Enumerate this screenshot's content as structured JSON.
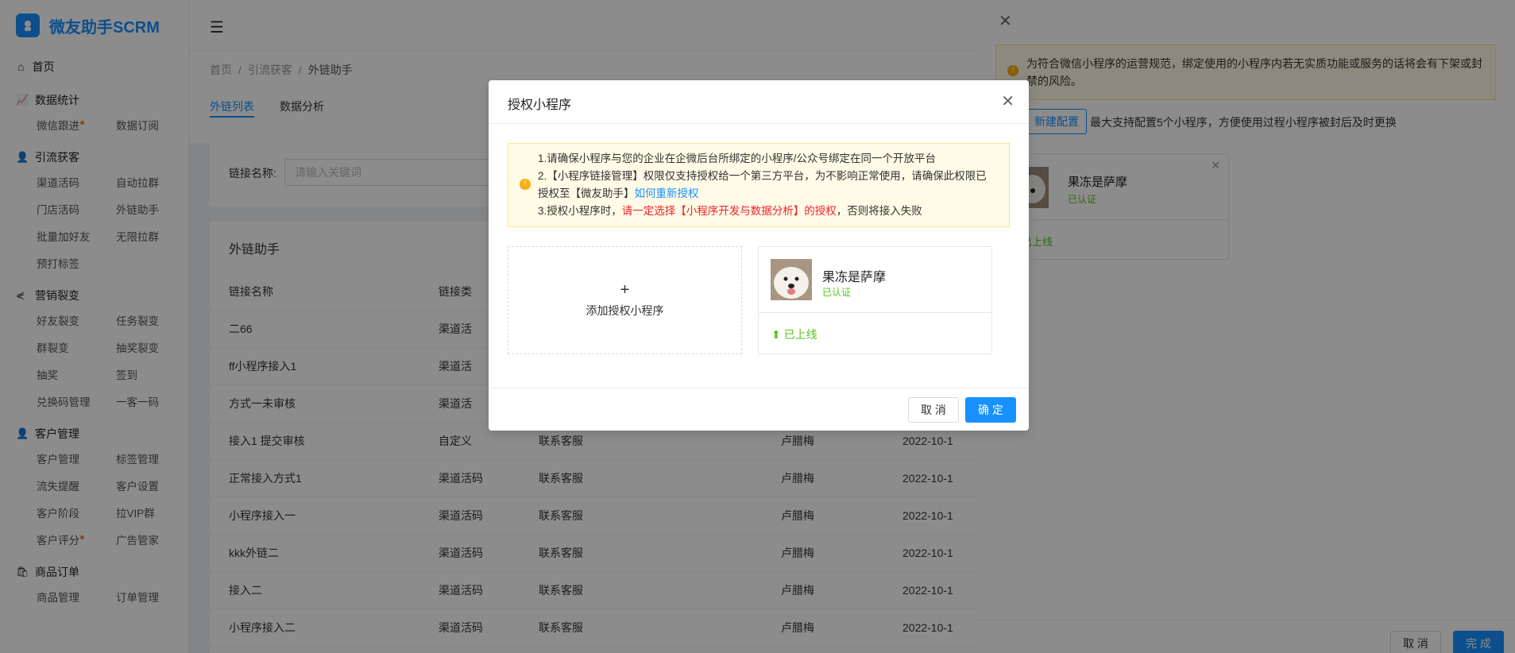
{
  "app": {
    "title": "微友助手SCRM"
  },
  "sidebar": {
    "home": "首页",
    "groups": [
      {
        "title": "数据统计",
        "items": [
          "微信跟进",
          "数据订阅"
        ]
      },
      {
        "title": "引流获客",
        "items": [
          "渠道活码",
          "自动拉群",
          "门店活码",
          "外链助手",
          "批量加好友",
          "无限拉群",
          "预打标签"
        ]
      },
      {
        "title": "营销裂变",
        "items": [
          "好友裂变",
          "任务裂变",
          "群裂变",
          "抽奖裂变",
          "抽奖",
          "签到",
          "兑换码管理",
          "一客一码"
        ]
      },
      {
        "title": "客户管理",
        "items": [
          "客户管理",
          "标签管理",
          "流失提醒",
          "客户设置",
          "客户阶段",
          "拉VIP群",
          "客户评分",
          "广告管家"
        ]
      },
      {
        "title": "商品订单",
        "items": [
          "商品管理",
          "订单管理"
        ]
      }
    ]
  },
  "breadcrumb": [
    "首页",
    "引流获客",
    "外链助手"
  ],
  "breadcrumb_sep": "/",
  "tabs": [
    "外链列表",
    "数据分析"
  ],
  "filter": {
    "label": "链接名称:",
    "placeholder": "请输入关键词"
  },
  "list": {
    "title": "外链助手",
    "headers": [
      "链接名称",
      "链接类"
    ],
    "rows": [
      [
        "二66",
        "渠道活",
        "",
        "",
        ""
      ],
      [
        "ff小程序接入1",
        "渠道活",
        "",
        "",
        ""
      ],
      [
        "方式一未审核",
        "渠道活",
        "",
        "",
        ""
      ],
      [
        "接入1 提交审核",
        "自定义",
        "联系客服",
        "卢腊梅",
        "2022-10-1"
      ],
      [
        "正常接入方式1",
        "渠道活码",
        "联系客服",
        "卢腊梅",
        "2022-10-1"
      ],
      [
        "小程序接入一",
        "渠道活码",
        "联系客服",
        "卢腊梅",
        "2022-10-1"
      ],
      [
        "kkk外链二",
        "渠道活码",
        "联系客服",
        "卢腊梅",
        "2022-10-1"
      ],
      [
        "接入二",
        "渠道活码",
        "联系客服",
        "卢腊梅",
        "2022-10-1"
      ],
      [
        "小程序接入二",
        "渠道活码",
        "联系客服",
        "卢腊梅",
        "2022-10-1"
      ]
    ]
  },
  "drawer": {
    "alert": "为符合微信小程序的运营规范，绑定使用的小程序内若无实质功能或服务的话将会有下架或封禁的风险。",
    "new_button": "新建配置",
    "tip": "最大支持配置5个小程序，方便使用过程小程序被封后及时更换",
    "card": {
      "name": "果冻是萨摩",
      "verified": "已认证",
      "status": "已上线"
    },
    "cancel": "取 消",
    "done": "完 成"
  },
  "modal": {
    "title": "授权小程序",
    "alert": {
      "line1": "1.请确保小程序与您的企业在企微后台所绑定的小程序/公众号绑定在同一个开放平台",
      "line2": "2.【小程序链接管理】权限仅支持授权给一个第三方平台，为不影响正常使用，请确保此权限已授权至【微友助手】",
      "line2_link": "如何重新授权",
      "line3_pre": "3.授权小程序时，",
      "line3_red": "请一定选择【小程序开发与数据分析】的授权",
      "line3_post": "，否则将接入失败"
    },
    "add_label": "添加授权小程序",
    "card": {
      "name": "果冻是萨摩",
      "verified": "已认证",
      "status": "已上线"
    },
    "cancel": "取 消",
    "ok": "确 定"
  },
  "colors": {
    "primary": "#1890ff",
    "success": "#52c41a",
    "warning": "#faad14",
    "danger": "#f5222d"
  }
}
